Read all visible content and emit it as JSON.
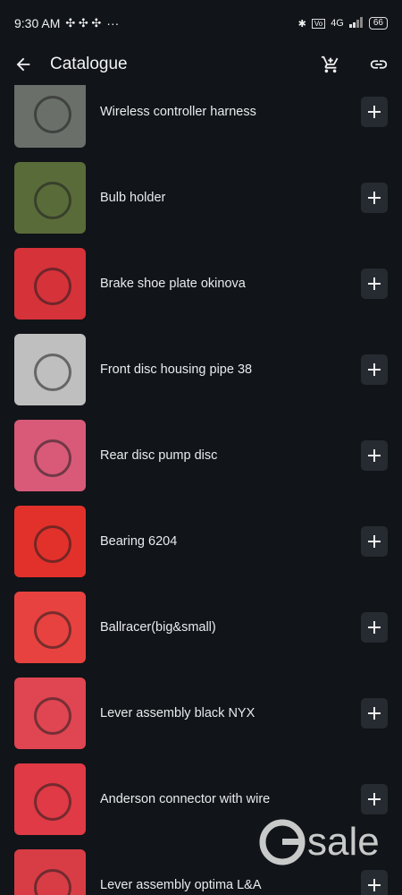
{
  "status": {
    "time": "9:30 AM",
    "dots": "···",
    "network": "4G",
    "battery": "66"
  },
  "header": {
    "title": "Catalogue"
  },
  "items": [
    {
      "name": "Wireless controller harness",
      "color": "#6b6f6a"
    },
    {
      "name": "Bulb holder",
      "color": "#5a6b3a"
    },
    {
      "name": "Brake shoe plate okinova",
      "color": "#d6323a"
    },
    {
      "name": "Front disc housing pipe 38",
      "color": "#bfbfc0"
    },
    {
      "name": "Rear disc pump disc",
      "color": "#d85a78"
    },
    {
      "name": "Bearing 6204",
      "color": "#e2312b"
    },
    {
      "name": "Ballracer(big&small)",
      "color": "#e7423f"
    },
    {
      "name": "Lever assembly black NYX",
      "color": "#e04552"
    },
    {
      "name": "Anderson connector with wire",
      "color": "#df3a45"
    },
    {
      "name": "Lever assembly optima L&A",
      "color": "#d83d46"
    }
  ],
  "watermark": {
    "letter": "G",
    "text": "sale"
  }
}
